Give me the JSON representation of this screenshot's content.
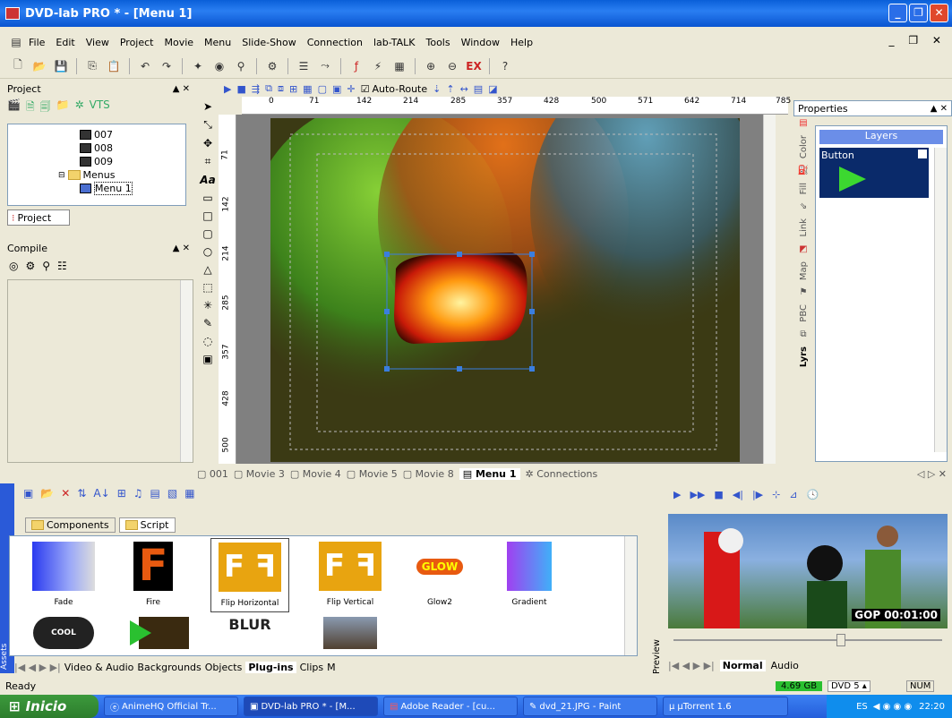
{
  "title": "DVD-lab PRO * - [Menu 1]",
  "menu": [
    "File",
    "Edit",
    "View",
    "Project",
    "Movie",
    "Menu",
    "Slide-Show",
    "Connection",
    "lab-TALK",
    "Tools",
    "Window",
    "Help"
  ],
  "toolbar": {
    "auto_route_label": "Auto-Route",
    "auto_route_checked": true
  },
  "project_panel": {
    "title": "Project",
    "items": [
      "007",
      "008",
      "009",
      "Menus",
      "Menu 1"
    ],
    "tab": "Project"
  },
  "compile_panel": {
    "title": "Compile"
  },
  "ruler": {
    "h": [
      "0",
      "71",
      "142",
      "214",
      "285",
      "357",
      "428",
      "500",
      "571",
      "642",
      "714",
      "785"
    ],
    "v": [
      "71",
      "142",
      "214",
      "285",
      "357",
      "428",
      "500"
    ]
  },
  "properties": {
    "title": "Properties",
    "layers_label": "Layers",
    "layer_item": "Button",
    "side_tabs": [
      "Color",
      "Fill",
      "Link",
      "Map",
      "PBC",
      "Lyrs"
    ]
  },
  "editor_tabs": [
    "001",
    "Movie 3",
    "Movie 4",
    "Movie 5",
    "Movie 8",
    "Menu 1",
    "Connections"
  ],
  "assets": {
    "tabs": [
      "Components",
      "Script"
    ],
    "items": [
      "Fade",
      "Fire",
      "Flip Horizontal",
      "Flip Vertical",
      "Glow2",
      "Gradient"
    ],
    "row2": [
      "COOL",
      "",
      "BLUR",
      ""
    ],
    "bottom_tabs": [
      "Video & Audio",
      "Backgrounds",
      "Objects",
      "Plug-ins",
      "Clips",
      "M"
    ],
    "side_label": "Assets"
  },
  "preview": {
    "side_label": "Preview",
    "gop": "GOP 00:01:00",
    "tabs": [
      "Normal",
      "Audio"
    ]
  },
  "status": {
    "text": "Ready",
    "size": "4.69 GB",
    "disc": "DVD 5",
    "num": "NUM"
  },
  "taskbar": {
    "start": "Inicio",
    "tasks": [
      "AnimeHQ Official Tr...",
      "DVD-lab PRO * - [M...",
      "Adobe Reader - [cu...",
      "dvd_21.JPG - Paint",
      "µTorrent 1.6"
    ],
    "lang": "ES",
    "time": "22:20"
  },
  "colors": {
    "title_blue": "#0a5fd8",
    "taskbar": "#245edb",
    "start_green": "#3c9a3c"
  }
}
